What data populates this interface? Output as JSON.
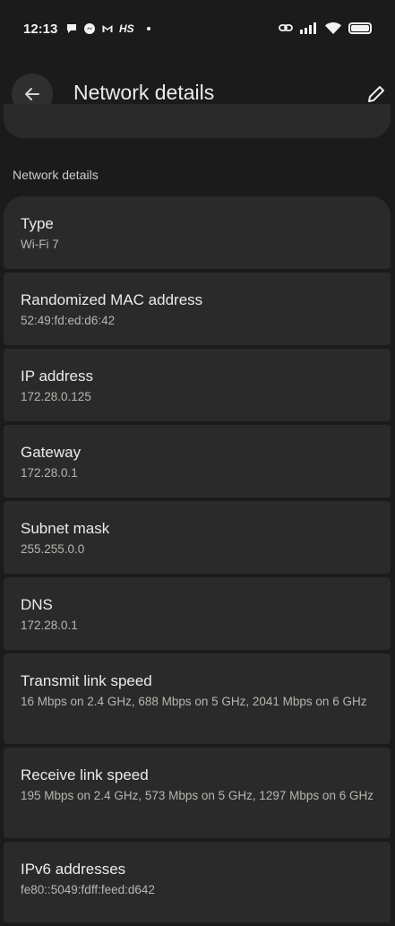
{
  "status_bar": {
    "time": "12:13",
    "hs_label": "HS",
    "left_icons": [
      "chat-bubble-icon",
      "messenger-icon",
      "gmail-icon",
      "hs-app-icon",
      "notification-dot-icon"
    ],
    "right_icons": [
      "link-icon",
      "cellular-signal-icon",
      "wifi-icon",
      "battery-icon"
    ]
  },
  "app_bar": {
    "title": "Network details",
    "back_icon": "arrow-back-icon",
    "edit_icon": "pencil-edit-icon"
  },
  "section": {
    "header": "Network details"
  },
  "items": [
    {
      "title": "Type",
      "value": "Wi-Fi 7"
    },
    {
      "title": "Randomized MAC address",
      "value": "52:49:fd:ed:d6:42"
    },
    {
      "title": "IP address",
      "value": "172.28.0.125"
    },
    {
      "title": "Gateway",
      "value": "172.28.0.1"
    },
    {
      "title": "Subnet mask",
      "value": "255.255.0.0"
    },
    {
      "title": "DNS",
      "value": "172.28.0.1"
    },
    {
      "title": "Transmit link speed",
      "value": "16 Mbps on 2.4 GHz, 688 Mbps on 5 GHz, 2041 Mbps on 6 GHz"
    },
    {
      "title": "Receive link speed",
      "value": "195 Mbps on 2.4 GHz, 573 Mbps on 5 GHz, 1297 Mbps on 6 GHz"
    },
    {
      "title": "IPv6 addresses",
      "value": "fe80::5049:fdff:feed:d642"
    }
  ],
  "colors": {
    "background": "#1b1b1b",
    "card": "#2a2a2a",
    "text_primary": "#ecebe8",
    "text_secondary": "#b9b5b0"
  }
}
